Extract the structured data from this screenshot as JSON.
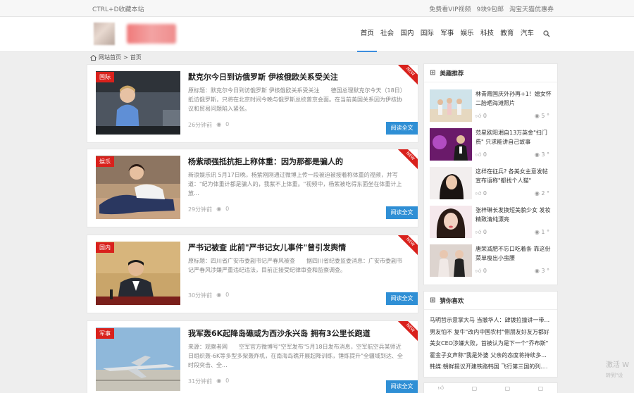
{
  "topbar": {
    "bookmark_hint": "CTRL+D收藏本站",
    "links": [
      "免费看VIP视频",
      "9块9包邮",
      "淘宝天猫优惠券"
    ]
  },
  "nav": {
    "items": [
      "首页",
      "社会",
      "国内",
      "国际",
      "军事",
      "娱乐",
      "科技",
      "教育",
      "汽车"
    ],
    "active_index": 0
  },
  "breadcrumb": {
    "home": "网站首页",
    "separator": ">",
    "current": "首页"
  },
  "articles": [
    {
      "tag": "国际",
      "badge": "NEW",
      "title": "默克尔今日到访俄罗斯 伊核俄欧关系受关注",
      "excerpt": "原标题：默克尔今日到访俄罗斯 伊核俄欧关系受关注　　德国总理默克尔今天（18日）抵访俄罗斯，只将在北京时间今晚与俄罗斯总统普京会面。在当前美国关系因为伊核协议和贸易问题陷入紧张。",
      "time": "26分钟前",
      "views": "0",
      "more": "阅读全文"
    },
    {
      "tag": "娱乐",
      "badge": "NEW",
      "title": "杨紫顽强抵抗拒上称体重：因为那都是骗人的",
      "excerpt": "新浪娱乐讯 5月17日晚，杨紫刚刚通过微博上传一段被迫被按着称体重的视频，并写道：\"纪为体重计都是骗人的，我紫不上体重。\"视频中，杨紫被吃得东面坐在体重计上放...",
      "time": "29分钟前",
      "views": "0",
      "more": "阅读全文"
    },
    {
      "tag": "国内",
      "badge": "NEW",
      "title": "严书记被查 此前\"严书记女儿事件\"曾引发舆情",
      "excerpt": "原标题：四川省广安市委副书记严春风被查　　据四川省纪委监委消息：广安市委副书记严春风涉嫌严重违纪违法，目前正接受纪律审查和监察调查。",
      "time": "30分钟前",
      "views": "0",
      "more": "阅读全文"
    },
    {
      "tag": "军事",
      "badge": "NEW",
      "title": "我军轰6K起降岛礁或为西沙永兴岛 拥有3公里长跑道",
      "excerpt": "来源：观察者网　　空军官方微博号\"空军发布\"5月18日发布消息，空军航空兵某师近日组织轰-6K等多型多架轰炸机，在南海岛礁开展起降训练，锤炼提升\"全疆域到达、全时段突击、全...",
      "time": "31分钟前",
      "views": "0",
      "more": "阅读全文"
    }
  ],
  "sidebar": {
    "featured_title": "美趣推荐",
    "featured": [
      {
        "title": "林青霞国庆外孙再+1！媳女怀二胎晒海滩照片",
        "likes": "0",
        "views": "5"
      },
      {
        "title": "范星欧阳湘自13万英金\"扫门费\" 只求能讲自己故事",
        "likes": "0",
        "views": "3"
      },
      {
        "title": "这样在征兵? 各美女主意发帖宣布语称\"都找个人猫\"",
        "likes": "0",
        "views": "2"
      },
      {
        "title": "张梓琳长发换短美貌少女 发妆精致清纯漂亮",
        "likes": "0",
        "views": "1"
      },
      {
        "title": "唐荣减肥不忘口吃着条 靠这份菜单瘦出小蛮腰",
        "likes": "0",
        "views": "3"
      }
    ],
    "guess_title": "猜你喜欢",
    "guess": [
      "马明哲示意掌大马 当撤华人：肆镀拉撞讲一带...",
      "男友怕不 复牛\"改内中国农村\"侧朋友好友万都好",
      "美女CEO涉嫌大败，首被认为是下一个\"乔布斯\"",
      "霍金子女声称\"我是外婆 父亲的态度将持续多...",
      "韩媒:朝鲜提议开建铁路韩国 飞行第三国的列...."
    ]
  },
  "watermark": {
    "line1": "激活 W",
    "line2": "转到\"设"
  }
}
